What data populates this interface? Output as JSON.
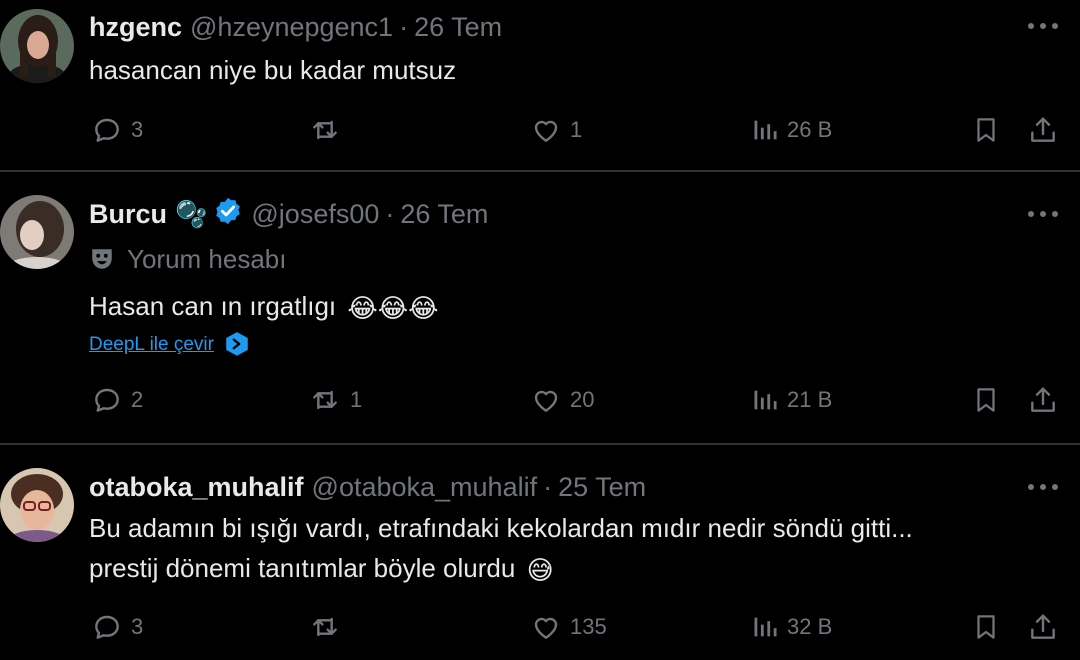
{
  "tweets": [
    {
      "name": "hzgenc",
      "handle": "@hzeynepgenc1",
      "separator": "·",
      "time": "26 Tem",
      "text": "hasancan niye bu kadar mutsuz",
      "replies": "3",
      "retweets": "",
      "likes": "1",
      "views": "26 B"
    },
    {
      "name": "Burcu",
      "name_emoji": "🫧",
      "handle": "@josefs00",
      "separator": "·",
      "time": "26 Tem",
      "community": "Yorum hesabı",
      "text": "Hasan can ın ırgatlıgı",
      "text_emojis": "😂😂😂",
      "translate": "DeepL ile çevir",
      "replies": "2",
      "retweets": "1",
      "likes": "20",
      "views": "21 B"
    },
    {
      "name": "otaboka_muhalif",
      "handle": "@otaboka_muhalif",
      "separator": "·",
      "time": "25 Tem",
      "text_line1": "Bu adamın bi ışığı vardı, etrafındaki kekolardan mıdır nedir söndü gitti...",
      "text_line2": "prestij dönemi tanıtımlar böyle olurdu",
      "text_emoji": "😅",
      "replies": "3",
      "retweets": "",
      "likes": "135",
      "views": "32 B"
    }
  ],
  "icons": [
    "more-icon",
    "reply-icon",
    "retweet-icon",
    "like-icon",
    "views-icon",
    "bookmark-icon",
    "share-icon",
    "verified-badge-icon",
    "comedy-mask-icon",
    "deepl-icon"
  ],
  "colors": {
    "background": "#000000",
    "text": "#e7e9ea",
    "muted": "#71767b",
    "link": "#1d9bf0",
    "divider": "#2f3336"
  }
}
